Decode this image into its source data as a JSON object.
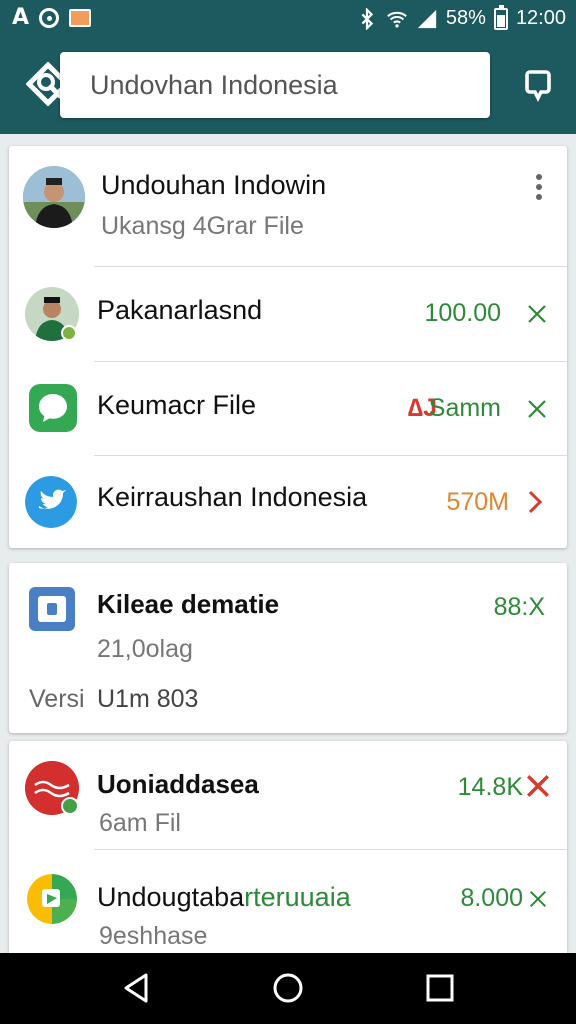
{
  "status_bar": {
    "left_letter": "A",
    "battery": "58%",
    "time": "12:00",
    "icons": [
      "google-icon",
      "image-icon",
      "bluetooth-icon",
      "wifi-icon",
      "signal-icon",
      "battery-icon"
    ]
  },
  "search": {
    "value": "Undovhan Indonesia",
    "placeholder": "Undovhan Indonesia"
  },
  "card1": {
    "header": {
      "title": "Undouhan Indowin",
      "subtitle": "Ukansg  4Grar File",
      "menu_icon": "more-vert-icon"
    },
    "items": [
      {
        "title": "Pakanarlasnd",
        "value": "100.00",
        "value_color": "#2e8a3a",
        "action_icon": "close-icon"
      },
      {
        "title": "Keumacr File",
        "badge": "∆J",
        "value": "Samm",
        "value_color": "#2e8a3a",
        "action_icon": "close-icon"
      },
      {
        "title": "Keirraushan Indonesia",
        "value": "570M",
        "value_color": "#e0862f",
        "action_icon": "chevron-right-icon"
      }
    ]
  },
  "card2": {
    "title": "Kileae dematie",
    "value": "88:X",
    "subtitle": "21,0olag",
    "version_label": "Versi",
    "version_value": "U1m 803"
  },
  "card3": {
    "items": [
      {
        "title": "Uoniaddasea",
        "subtitle": "6am Fil",
        "value": "14.8K",
        "action_icon": "close-icon"
      },
      {
        "title": "Undougtaba",
        "title_accent": "rteruuaia",
        "subtitle": "9eshhase",
        "value": "8.000",
        "action_icon": "close-icon"
      }
    ]
  },
  "nav": {
    "icons": [
      "back-icon",
      "home-icon",
      "recents-icon"
    ]
  },
  "colors": {
    "app_bar": "#1c5a5f",
    "green": "#2e8a3a",
    "orange": "#e0862f",
    "red": "#d83b2e"
  }
}
